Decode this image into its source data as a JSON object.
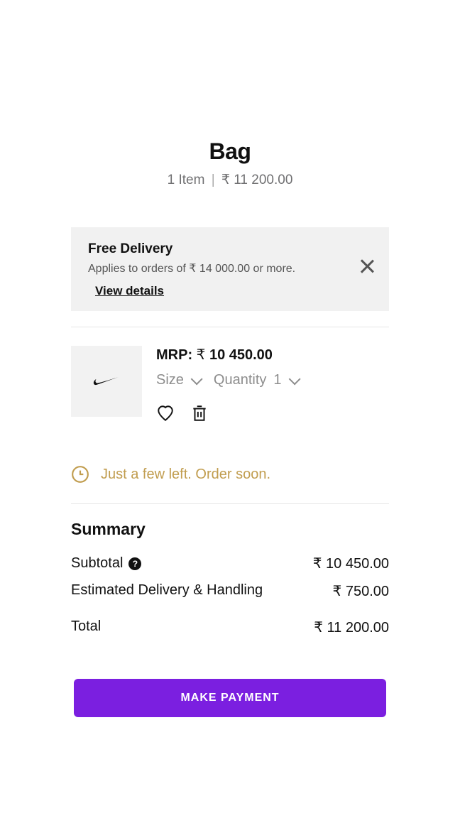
{
  "header": {
    "title": "Bag",
    "item_count": "1 Item",
    "total": "₹ 11 200.00"
  },
  "banner": {
    "title": "Free Delivery",
    "subtitle": "Applies to orders of ₹ 14 000.00 or more.",
    "link": "View details"
  },
  "item": {
    "mrp_label": "MRP:",
    "mrp_value": "₹ 10 450.00",
    "size_label": "Size",
    "qty_label": "Quantity",
    "qty_value": "1"
  },
  "urgency": {
    "text": "Just a few left. Order soon."
  },
  "summary": {
    "title": "Summary",
    "subtotal_label": "Subtotal",
    "subtotal_value": "₹ 10 450.00",
    "delivery_label": "Estimated Delivery & Handling",
    "delivery_value": "₹ 750.00",
    "total_label": "Total",
    "total_value": "₹ 11 200.00"
  },
  "cta": {
    "label": "MAKE PAYMENT"
  }
}
